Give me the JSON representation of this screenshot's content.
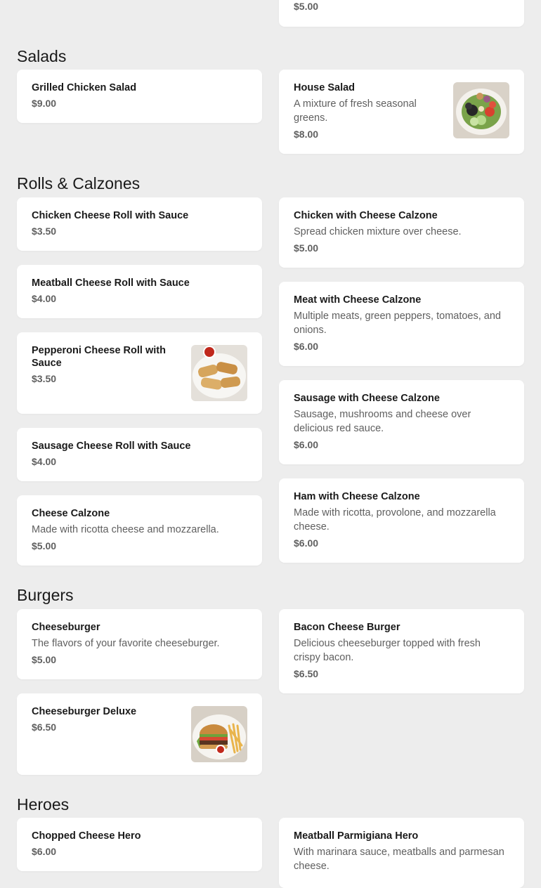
{
  "top_card": {
    "price": "$5.00"
  },
  "sections": {
    "salads": {
      "title": "Salads",
      "items": [
        {
          "name": "Grilled Chicken Salad",
          "price": "$9.00"
        },
        {
          "name": "House Salad",
          "desc": "A mixture of fresh seasonal greens.",
          "price": "$8.00",
          "image": "salad-photo"
        }
      ]
    },
    "rolls": {
      "title": "Rolls & Calzones",
      "items": [
        {
          "name": "Chicken Cheese Roll with Sauce",
          "price": "$3.50"
        },
        {
          "name": "Chicken with Cheese Calzone",
          "desc": "Spread chicken mixture over cheese.",
          "price": "$5.00"
        },
        {
          "name": "Meatball Cheese Roll with Sauce",
          "price": "$4.00"
        },
        {
          "name": "Meat with Cheese Calzone",
          "desc": "Multiple meats, green peppers, tomatoes, and onions.",
          "price": "$6.00"
        },
        {
          "name": "Pepperoni Cheese Roll with Sauce",
          "price": "$3.50",
          "image": "rolls-photo"
        },
        {
          "name": "Sausage with Cheese Calzone",
          "desc": "Sausage, mushrooms and cheese over delicious red sauce.",
          "price": "$6.00"
        },
        {
          "name": "Sausage Cheese Roll with Sauce",
          "price": "$4.00"
        },
        {
          "name": "Ham with Cheese Calzone",
          "desc": "Made with ricotta, provolone, and mozzarella cheese.",
          "price": "$6.00"
        },
        {
          "name": "Cheese Calzone",
          "desc": "Made with ricotta cheese and mozzarella.",
          "price": "$5.00"
        }
      ]
    },
    "burgers": {
      "title": "Burgers",
      "items": [
        {
          "name": "Cheeseburger",
          "desc": "The flavors of your favorite cheeseburger.",
          "price": "$5.00"
        },
        {
          "name": "Bacon Cheese Burger",
          "desc": "Delicious cheeseburger topped with fresh crispy bacon.",
          "price": "$6.50"
        },
        {
          "name": "Cheeseburger Deluxe",
          "price": "$6.50",
          "image": "burger-photo"
        }
      ]
    },
    "heroes": {
      "title": "Heroes",
      "items": [
        {
          "name": "Chopped Cheese Hero",
          "price": "$6.00"
        },
        {
          "name": "Meatball Parmigiana Hero",
          "desc": "With marinara sauce, meatballs and parmesan cheese.",
          "price": ""
        }
      ]
    }
  }
}
